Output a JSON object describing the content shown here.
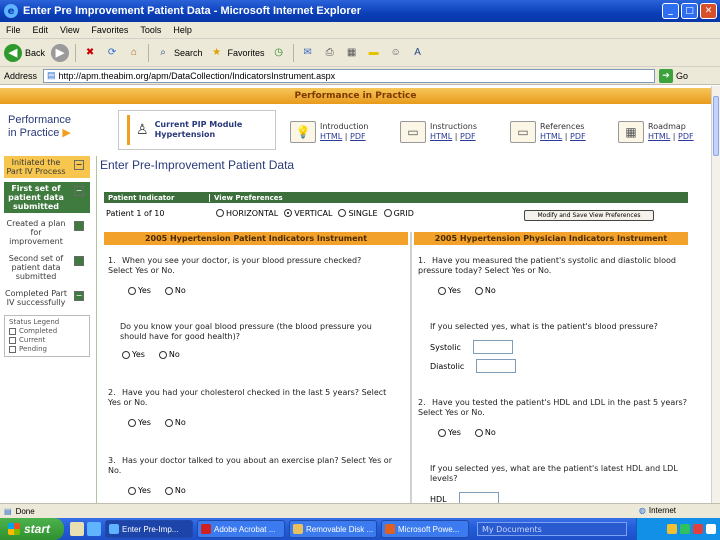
{
  "window": {
    "title": "Enter Pre Improvement Patient Data - Microsoft Internet Explorer"
  },
  "menu": [
    "File",
    "Edit",
    "View",
    "Favorites",
    "Tools",
    "Help"
  ],
  "toolbar": {
    "back": "Back",
    "search": "Search",
    "favorites": "Favorites"
  },
  "address": {
    "label": "Address",
    "url": "http://apm.theabim.org/apm/DataCollection/IndicatorsInstrument.aspx",
    "go": "Go"
  },
  "banner": "Performance in Practice",
  "logo": {
    "line1": "Performance",
    "line2": "in Practice"
  },
  "module": {
    "line1": "Current PIP Module",
    "line2": "Hypertension"
  },
  "doc_links": [
    {
      "title": "Introduction",
      "html": "HTML",
      "pdf": "PDF"
    },
    {
      "title": "Instructions",
      "html": "HTML",
      "pdf": "PDF"
    },
    {
      "title": "References",
      "html": "HTML",
      "pdf": "PDF"
    },
    {
      "title": "Roadmap",
      "html": "HTML",
      "pdf": "PDF"
    }
  ],
  "sidebar": {
    "items": [
      {
        "label": "Initiated the Part IV Process",
        "status": "completed",
        "mark": "−"
      },
      {
        "label": "First set of patient data submitted",
        "status": "current",
        "mark": "−"
      },
      {
        "label": "Created a plan for improvement",
        "status": "pending",
        "mark": ""
      },
      {
        "label": "Second set of patient data submitted",
        "status": "pending",
        "mark": ""
      },
      {
        "label": "Completed Part IV successfully",
        "status": "completed",
        "mark": "−"
      }
    ],
    "legend": {
      "title": "Status Legend",
      "completed": "Completed",
      "current": "Current",
      "pending": "Pending"
    }
  },
  "main": {
    "title": "Enter Pre-Improvement Patient Data",
    "pref_header": {
      "c1": "Patient Indicator",
      "c2": "View Preferences"
    },
    "patient_count": "Patient 1 of 10",
    "view_options": [
      "HORIZONTAL",
      "VERTICAL",
      "SINGLE",
      "GRID"
    ],
    "selected_view": "VERTICAL",
    "apply_button": "Modify and Save View Preferences",
    "left_header": "2005 Hypertension Patient Indicators Instrument",
    "right_header": "2005 Hypertension Physician Indicators Instrument"
  },
  "left_questions": [
    {
      "num": "1.",
      "text": "When you see your doctor, is your blood pressure checked? Select Yes or No."
    },
    {
      "num": "",
      "text": "Do you know your goal blood pressure (the blood pressure you should have for good health)?"
    },
    {
      "num": "2.",
      "text": "Have you had your cholesterol checked in the last 5 years? Select Yes or No."
    },
    {
      "num": "3.",
      "text": "Has your doctor talked to you about an exercise plan? Select Yes or No."
    }
  ],
  "right_questions": [
    {
      "num": "1.",
      "text": "Have you measured the patient's systolic and diastolic blood pressure today? Select Yes or No."
    },
    {
      "num": "",
      "text": "If you selected yes, what is the patient's blood pressure?"
    },
    {
      "num": "2.",
      "text": "Have you tested the patient's HDL and LDL in the past 5 years? Select Yes or No."
    },
    {
      "num": "",
      "text": "If you selected yes, what are the patient's latest HDL and LDL levels?"
    }
  ],
  "answers": {
    "yes": "Yes",
    "no": "No"
  },
  "fields": {
    "systolic": "Systolic",
    "diastolic": "Diastolic",
    "hdl": "HDL"
  },
  "status": {
    "left": "Done",
    "zone": "Internet"
  },
  "taskbar": {
    "start": "start",
    "tasks": [
      "Enter Pre-Imp...",
      "Adobe Acrobat ...",
      "Removable Disk ...",
      "Microsoft Powe..."
    ],
    "search_placeholder": "My Documents"
  },
  "colors": {
    "accent_orange": "#f2a22a",
    "current_green": "#3f7a3f",
    "completed_yellow": "#f6c64e",
    "title_blue": "#0a3fb8"
  }
}
